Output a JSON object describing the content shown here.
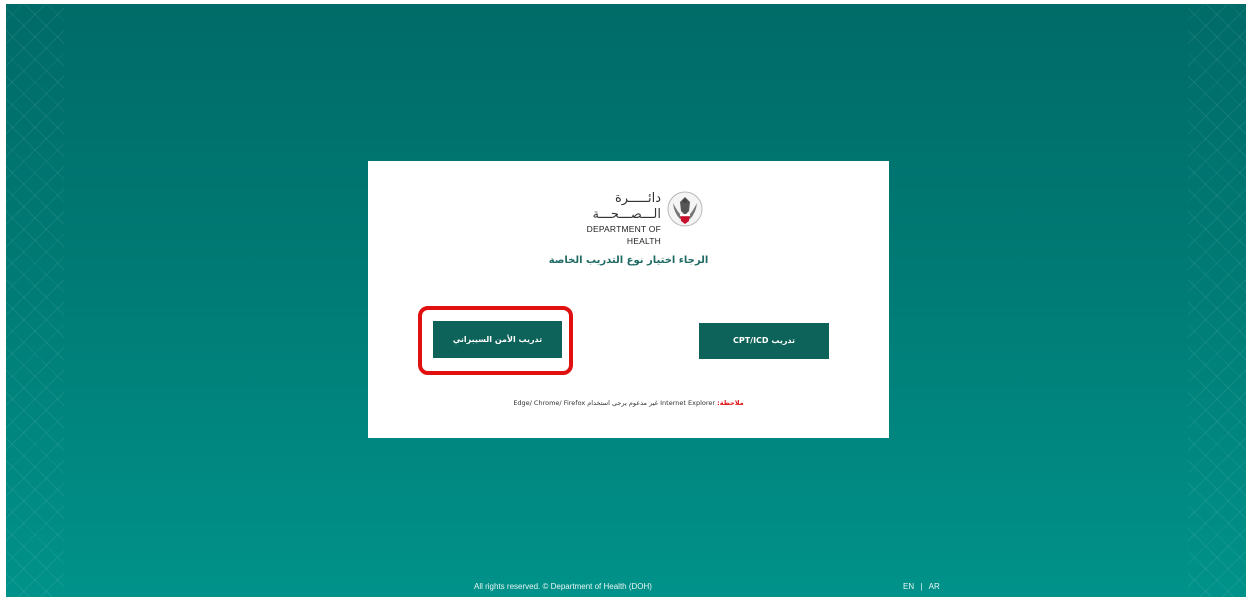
{
  "logo": {
    "arabic": "دائـــــرة الـــصـــحـــة",
    "english": "DEPARTMENT OF HEALTH",
    "icon": "falcon-emblem-icon"
  },
  "prompt": "الرجاء اختيار نوع التدريب الخاصة",
  "buttons": {
    "cyber": "تدريب الأمن السيبراني",
    "cpt": "CPT/ICD تدريب"
  },
  "note": {
    "label": "ملاحظة:",
    "text": " Internet Explorer غير مدعوم يرجى استخدام Edge/ Chrome/ Firefox"
  },
  "footer": {
    "copyright": "All rights reserved. © Department of Health (DOH)",
    "lang_en": "EN",
    "separator": "|",
    "lang_ar": "AR"
  },
  "colors": {
    "background_top": "#006b68",
    "background_bottom": "#00928a",
    "button": "#0d6259",
    "highlight": "#e01010",
    "prompt": "#1e6b63"
  }
}
